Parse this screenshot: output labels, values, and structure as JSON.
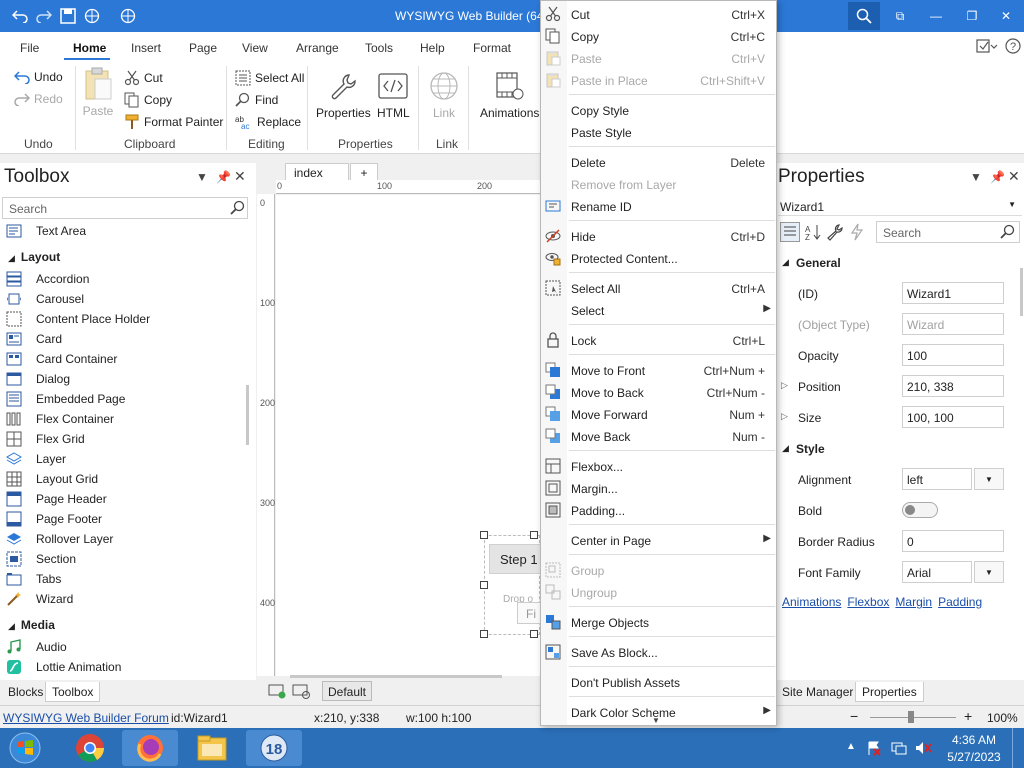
{
  "window": {
    "title": "WYSIWYG Web Builder (64-b"
  },
  "menu": {
    "items": [
      "File",
      "Home",
      "Insert",
      "Page",
      "View",
      "Arrange",
      "Tools",
      "Help",
      "Format"
    ],
    "active": "Home"
  },
  "ribbon": {
    "undo": "Undo",
    "redo": "Redo",
    "undo_group": "Undo",
    "paste": "Paste",
    "cut": "Cut",
    "copy": "Copy",
    "format_painter": "Format Painter",
    "clipboard_group": "Clipboard",
    "select_all": "Select All",
    "find": "Find",
    "replace": "Replace",
    "editing_group": "Editing",
    "properties": "Properties",
    "html": "HTML",
    "properties_group": "Properties",
    "link": "Link",
    "link_group": "Link",
    "animations": "Animations"
  },
  "toolbox": {
    "title": "Toolbox",
    "search_placeholder": "Search",
    "top_item": "Text Area",
    "layout_group": "Layout",
    "layout_items": [
      "Accordion",
      "Carousel",
      "Content Place Holder",
      "Card",
      "Card Container",
      "Dialog",
      "Embedded Page",
      "Flex Container",
      "Flex Grid",
      "Layer",
      "Layout Grid",
      "Page Header",
      "Page Footer",
      "Rollover Layer",
      "Section",
      "Tabs",
      "Wizard"
    ],
    "media_group": "Media",
    "media_items": [
      "Audio",
      "Lottie Animation"
    ],
    "tabs": [
      "Blocks",
      "Toolbox"
    ]
  },
  "document": {
    "tab": "index",
    "add_tab": "+",
    "ruler_top": [
      "0",
      "100",
      "200"
    ],
    "ruler_left": [
      "0",
      "100",
      "200",
      "300",
      "400"
    ],
    "wizard_step": "Step 1",
    "drop_text": "Drop o",
    "fin_text": "Fi",
    "default_btn": "Default"
  },
  "properties": {
    "title": "Properties",
    "object": "Wizard1",
    "search_placeholder": "Search",
    "general": "General",
    "style": "Style",
    "rows": [
      {
        "label": "(ID)",
        "value": "Wizard1",
        "disabled": false
      },
      {
        "label": "(Object Type)",
        "value": "Wizard",
        "disabled": true
      },
      {
        "label": "Opacity",
        "value": "100",
        "disabled": false
      },
      {
        "label": "Position",
        "value": "210, 338",
        "disabled": false
      },
      {
        "label": "Size",
        "value": "100, 100",
        "disabled": false
      }
    ],
    "style_rows": [
      {
        "label": "Alignment",
        "value": "left"
      },
      {
        "label": "Bold",
        "value": ""
      },
      {
        "label": "Border Radius",
        "value": "0"
      },
      {
        "label": "Font Family",
        "value": "Arial"
      }
    ],
    "links": [
      "Animations",
      "Flexbox",
      "Margin",
      "Padding"
    ],
    "tabs": [
      "Site Manager",
      "Properties"
    ]
  },
  "context_menu": {
    "items": [
      {
        "label": "Cut",
        "shortcut": "Ctrl+X",
        "disabled": false,
        "icon": "scissors-icon"
      },
      {
        "label": "Copy",
        "shortcut": "Ctrl+C",
        "disabled": false,
        "icon": "copy-icon"
      },
      {
        "label": "Paste",
        "shortcut": "Ctrl+V",
        "disabled": true,
        "icon": "paste-icon"
      },
      {
        "label": "Paste in Place",
        "shortcut": "Ctrl+Shift+V",
        "disabled": true,
        "icon": "paste-in-place-icon"
      },
      {
        "sep": true
      },
      {
        "label": "Copy Style",
        "shortcut": "",
        "disabled": false
      },
      {
        "label": "Paste Style",
        "shortcut": "",
        "disabled": false
      },
      {
        "sep": true
      },
      {
        "label": "Delete",
        "shortcut": "Delete",
        "disabled": false
      },
      {
        "label": "Remove from Layer",
        "shortcut": "",
        "disabled": true
      },
      {
        "label": "Rename ID",
        "shortcut": "",
        "disabled": false,
        "icon": "rename-icon"
      },
      {
        "sep": true
      },
      {
        "label": "Hide",
        "shortcut": "Ctrl+D",
        "disabled": false,
        "icon": "hide-icon"
      },
      {
        "label": "Protected Content...",
        "shortcut": "",
        "disabled": false,
        "icon": "protected-icon"
      },
      {
        "sep": true
      },
      {
        "label": "Select All",
        "shortcut": "Ctrl+A",
        "disabled": false,
        "icon": "select-all-icon"
      },
      {
        "label": "Select",
        "shortcut": "",
        "disabled": false,
        "submenu": true
      },
      {
        "sep": true
      },
      {
        "label": "Lock",
        "shortcut": "Ctrl+L",
        "disabled": false,
        "icon": "lock-icon"
      },
      {
        "sep": true
      },
      {
        "label": "Move to Front",
        "shortcut": "Ctrl+Num +",
        "disabled": false,
        "icon": "move-front-icon"
      },
      {
        "label": "Move to Back",
        "shortcut": "Ctrl+Num -",
        "disabled": false,
        "icon": "move-back-icon"
      },
      {
        "label": "Move Forward",
        "shortcut": "Num +",
        "disabled": false,
        "icon": "move-forward-icon"
      },
      {
        "label": "Move Back",
        "shortcut": "Num -",
        "disabled": false,
        "icon": "move-backward-icon"
      },
      {
        "sep": true
      },
      {
        "label": "Flexbox...",
        "shortcut": "",
        "disabled": false,
        "icon": "flexbox-icon"
      },
      {
        "label": "Margin...",
        "shortcut": "",
        "disabled": false,
        "icon": "margin-icon"
      },
      {
        "label": "Padding...",
        "shortcut": "",
        "disabled": false,
        "icon": "padding-icon"
      },
      {
        "sep": true
      },
      {
        "label": "Center in Page",
        "shortcut": "",
        "disabled": false,
        "submenu": true
      },
      {
        "sep": true
      },
      {
        "label": "Group",
        "shortcut": "",
        "disabled": true,
        "icon": "group-icon"
      },
      {
        "label": "Ungroup",
        "shortcut": "",
        "disabled": true,
        "icon": "ungroup-icon"
      },
      {
        "sep": true
      },
      {
        "label": "Merge Objects",
        "shortcut": "",
        "disabled": false,
        "icon": "merge-icon"
      },
      {
        "sep": true
      },
      {
        "label": "Save As Block...",
        "shortcut": "",
        "disabled": false,
        "icon": "save-block-icon"
      },
      {
        "sep": true
      },
      {
        "label": "Don't Publish Assets",
        "shortcut": "",
        "disabled": false
      },
      {
        "sep": true
      },
      {
        "label": "Dark Color Scheme",
        "shortcut": "",
        "disabled": false,
        "submenu": true
      }
    ]
  },
  "status": {
    "forum": "WYSIWYG Web Builder Forum",
    "id": "id:Wizard1",
    "pos": "x:210, y:338",
    "size": "w:100 h:100",
    "zoom": "100%"
  },
  "taskbar": {
    "time": "4:36 AM",
    "date": "5/27/2023"
  },
  "colors": {
    "accent": "#2b78d6",
    "taskbar": "#2a6fb8"
  }
}
